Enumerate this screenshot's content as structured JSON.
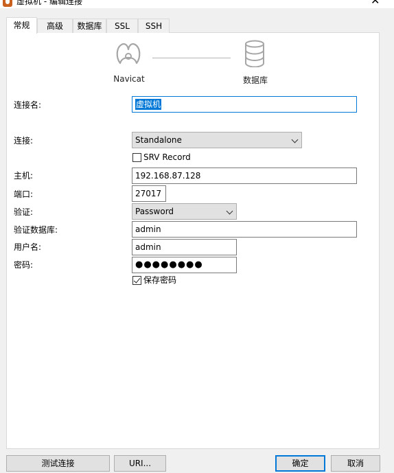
{
  "window": {
    "title": "虚拟机 - 编辑连接"
  },
  "tabs": [
    {
      "label": "常规",
      "active": true
    },
    {
      "label": "高级"
    },
    {
      "label": "数据库"
    },
    {
      "label": "SSL"
    },
    {
      "label": "SSH"
    }
  ],
  "diagram": {
    "left_label": "Navicat",
    "right_label": "数据库"
  },
  "form": {
    "connection_name": {
      "label": "连接名:",
      "value": "虚拟机"
    },
    "connection": {
      "label": "连接:",
      "value": "Standalone"
    },
    "srv_record": {
      "label": "SRV Record",
      "checked": false
    },
    "host": {
      "label": "主机:",
      "value": "192.168.87.128"
    },
    "port": {
      "label": "端口:",
      "value": "27017"
    },
    "auth": {
      "label": "验证:",
      "value": "Password"
    },
    "auth_db": {
      "label": "验证数据库:",
      "value": "admin"
    },
    "username": {
      "label": "用户名:",
      "value": "admin"
    },
    "password": {
      "label": "密码:",
      "value": "●●●●●●●●"
    },
    "save_password": {
      "label": "保存密码",
      "checked": true
    }
  },
  "buttons": {
    "test": "测试连接",
    "uri": "URI...",
    "ok": "确定",
    "cancel": "取消"
  },
  "colors": {
    "accent": "#0078d7",
    "brand": "#c9601e"
  }
}
